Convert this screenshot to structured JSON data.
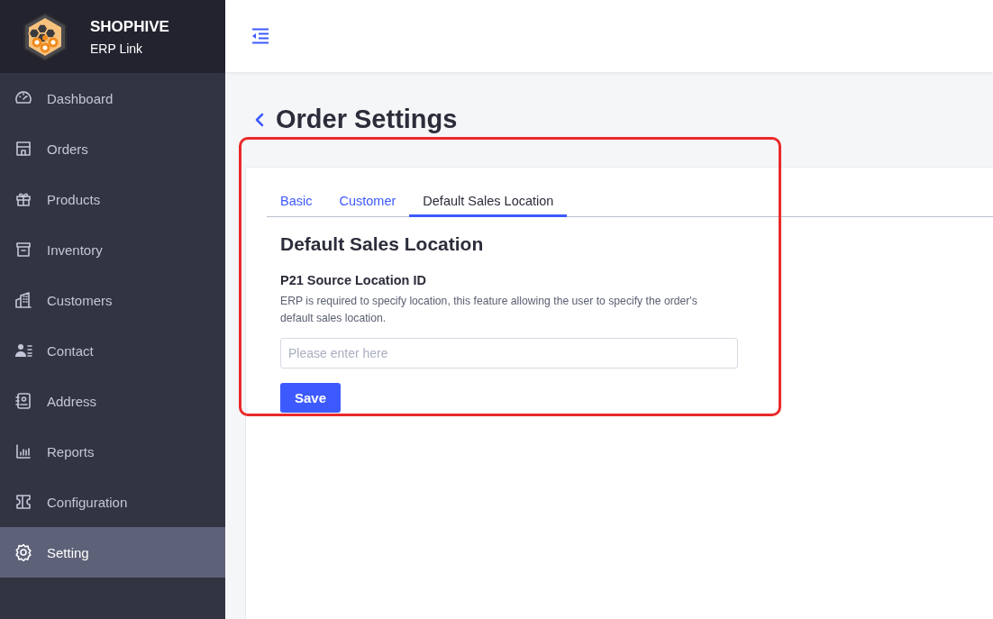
{
  "brand": {
    "name": "SHOPHIVE",
    "subtitle": "ERP Link"
  },
  "sidebar": {
    "items": [
      {
        "label": "Dashboard",
        "selected": false
      },
      {
        "label": "Orders",
        "selected": false
      },
      {
        "label": "Products",
        "selected": false
      },
      {
        "label": "Inventory",
        "selected": false
      },
      {
        "label": "Customers",
        "selected": false
      },
      {
        "label": "Contact",
        "selected": false
      },
      {
        "label": "Address",
        "selected": false
      },
      {
        "label": "Reports",
        "selected": false
      },
      {
        "label": "Configuration",
        "selected": false
      },
      {
        "label": "Setting",
        "selected": true
      }
    ]
  },
  "page": {
    "title": "Order Settings",
    "tabs": [
      {
        "label": "Basic",
        "selected": false
      },
      {
        "label": "Customer",
        "selected": false
      },
      {
        "label": "Default Sales Location",
        "selected": true
      }
    ],
    "section": {
      "heading": "Default Sales Location",
      "field_label": "P21 Source Location ID",
      "description": "ERP is required to specify location, this feature allowing the user to specify the order's default sales location.",
      "input": {
        "placeholder": "Please enter here"
      },
      "button": "Save"
    }
  }
}
